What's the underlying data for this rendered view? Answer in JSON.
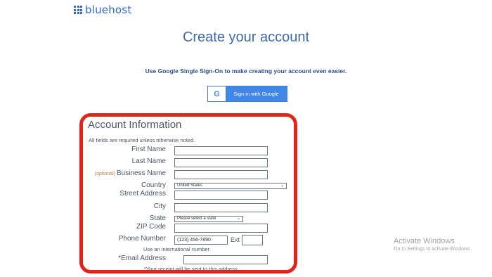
{
  "brand": {
    "name": "bluehost"
  },
  "page": {
    "title": "Create your account",
    "sso_text": "Use Google Single Sign-On to make creating your account even easier.",
    "google_button": {
      "icon": "G",
      "label": "Sign in with Google"
    }
  },
  "form": {
    "section_title": "Account Information",
    "required_note": "All fields are required unless otherwise noted.",
    "first_name": {
      "label": "First Name",
      "value": ""
    },
    "last_name": {
      "label": "Last Name",
      "value": ""
    },
    "business_name": {
      "optional_tag": "(optional)",
      "label": "Business Name",
      "value": ""
    },
    "country": {
      "label": "Country",
      "selected": "United States"
    },
    "street_address": {
      "label": "Street Address",
      "value": ""
    },
    "city": {
      "label": "City",
      "value": ""
    },
    "state": {
      "label": "State",
      "selected": "Please select a state"
    },
    "zip": {
      "label": "ZIP Code",
      "value": ""
    },
    "phone": {
      "label": "Phone Number",
      "placeholder": "(123) 456-7890",
      "ext_label": "Ext"
    },
    "intl_link": "Use an international number",
    "email": {
      "label": "*Email Address",
      "value": ""
    },
    "receipt_note": "*Your receipt will be sent to this address."
  },
  "watermark": {
    "title": "Activate Windows",
    "subtitle": "Go to Settings to activate Windows."
  },
  "colors": {
    "accent": "#2e66c9",
    "highlight": "#e1251b",
    "google_blue": "#3f86e6"
  }
}
